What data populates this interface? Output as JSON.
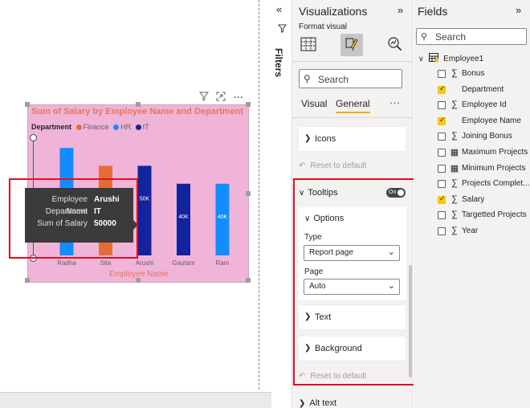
{
  "canvas": {
    "header_icons": [
      "filter-icon",
      "focus-mode-icon",
      "more-options-icon"
    ]
  },
  "chart_data": {
    "type": "bar",
    "title": "Sum of Salary by Employee Name and Department",
    "legend_title": "Department",
    "legend_position": "top-left",
    "series": [
      {
        "name": "Finance",
        "color": "#e66c37"
      },
      {
        "name": "HR",
        "color": "#118dff"
      },
      {
        "name": "IT",
        "color": "#12239e"
      }
    ],
    "categories": [
      "Radha",
      "Sita",
      "Arushi",
      "Gautam",
      "Ram"
    ],
    "bars": [
      {
        "category": "Radha",
        "series": "HR",
        "value": 60000,
        "label": ""
      },
      {
        "category": "Sita",
        "series": "Finance",
        "value": 50000,
        "label": ""
      },
      {
        "category": "Arushi",
        "series": "IT",
        "value": 50000,
        "label": "50K"
      },
      {
        "category": "Gautam",
        "series": "IT",
        "value": 40000,
        "label": "40K"
      },
      {
        "category": "Ram",
        "series": "HR",
        "value": 40000,
        "label": "40K"
      }
    ],
    "xlabel": "Employee Name",
    "ylabel": "",
    "ylim": [
      0,
      65000
    ],
    "grid": false
  },
  "tooltip": {
    "rows": [
      {
        "key": "Employee Name",
        "value": "Arushi"
      },
      {
        "key": "Department",
        "value": "IT"
      },
      {
        "key": "Sum of Salary",
        "value": "50000"
      }
    ]
  },
  "filters": {
    "label": "Filters"
  },
  "visualizations": {
    "title": "Visualizations",
    "format_label": "Format visual",
    "search_placeholder": "Search",
    "tabs": [
      "Visual",
      "General"
    ],
    "active_tab": "General",
    "icons_label": "Icons",
    "reset_label": "Reset to default",
    "tooltips_label": "Tooltips",
    "tooltips_toggle": "On",
    "options_label": "Options",
    "type_label": "Type",
    "type_value": "Report page",
    "page_label": "Page",
    "page_value": "Auto",
    "text_label": "Text",
    "background_label": "Background",
    "reset_label_2": "Reset to default",
    "alt_text_label": "Alt text"
  },
  "fields": {
    "title": "Fields",
    "search_placeholder": "Search",
    "table_name": "Employee1",
    "items": [
      {
        "name": "Bonus",
        "type": "sigma",
        "checked": false
      },
      {
        "name": "Department",
        "type": "none",
        "checked": true
      },
      {
        "name": "Employee Id",
        "type": "sigma",
        "checked": false
      },
      {
        "name": "Employee Name",
        "type": "none",
        "checked": true
      },
      {
        "name": "Joining Bonus",
        "type": "sigma",
        "checked": false
      },
      {
        "name": "Maximum Projects",
        "type": "calc",
        "checked": false
      },
      {
        "name": "Minimum Projects",
        "type": "calc",
        "checked": false
      },
      {
        "name": "Projects Complet...",
        "type": "sigma",
        "checked": false
      },
      {
        "name": "Salary",
        "type": "sigma",
        "checked": true
      },
      {
        "name": "Targetted Projects",
        "type": "sigma",
        "checked": false
      },
      {
        "name": "Year",
        "type": "sigma",
        "checked": false
      }
    ]
  }
}
